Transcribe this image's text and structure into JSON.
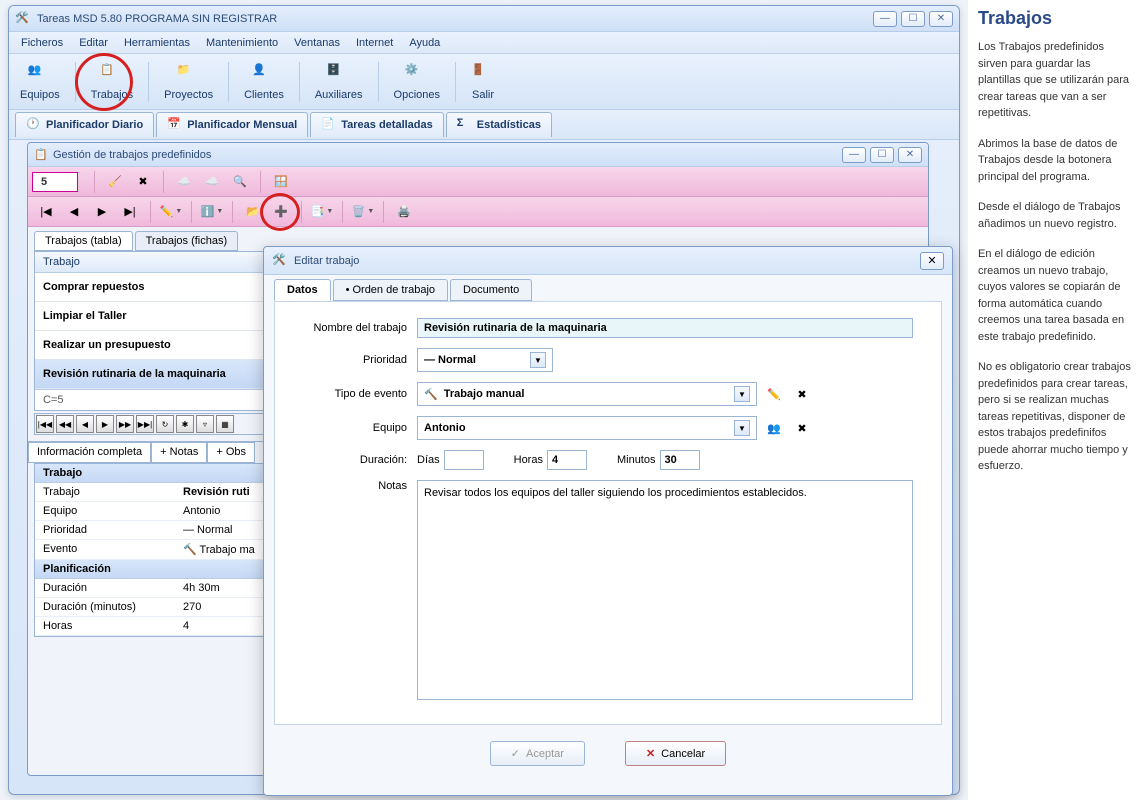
{
  "main_window": {
    "title": "Tareas MSD 5.80 PROGRAMA SIN REGISTRAR"
  },
  "menu": [
    "Ficheros",
    "Editar",
    "Herramientas",
    "Mantenimiento",
    "Ventanas",
    "Internet",
    "Ayuda"
  ],
  "toolbar": [
    {
      "label": "Equipos",
      "icon": "team-icon"
    },
    {
      "label": "Trabajos",
      "icon": "job-icon"
    },
    {
      "label": "Proyectos",
      "icon": "project-icon"
    },
    {
      "label": "Clientes",
      "icon": "client-icon"
    },
    {
      "label": "Auxiliares",
      "icon": "aux-icon"
    },
    {
      "label": "Opciones",
      "icon": "options-icon"
    },
    {
      "label": "Salir",
      "icon": "exit-icon"
    }
  ],
  "tabs": [
    "Planificador Diario",
    "Planificador Mensual",
    "Tareas detalladas",
    "Estadísticas"
  ],
  "child_window": {
    "title": "Gestión de trabajos predefinidos",
    "counter": "5",
    "table_tabs": [
      "Trabajos (tabla)",
      "Trabajos (fichas)"
    ],
    "header": "Trabajo",
    "rows": [
      "Comprar repuestos",
      "Limpiar el Taller",
      "Realizar un presupuesto",
      "Revisión rutinaria de la maquinaria"
    ],
    "footer": "C=5",
    "detail_tabs": [
      "Información completa",
      "+ Notas",
      "+ Obs"
    ],
    "detail": {
      "section1": "Trabajo",
      "trabajo_label": "Trabajo",
      "trabajo_val": "Revisión ruti",
      "equipo_label": "Equipo",
      "equipo_val": "Antonio",
      "prioridad_label": "Prioridad",
      "prioridad_val": "— Normal",
      "evento_label": "Evento",
      "evento_val": "🔨 Trabajo ma",
      "section2": "Planificación",
      "duracion_label": "Duración",
      "duracion_val": "4h 30m",
      "durmin_label": "Duración (minutos)",
      "durmin_val": "270",
      "horas_label": "Horas",
      "horas_val": "4"
    }
  },
  "dialog": {
    "title": "Editar trabajo",
    "tabs": [
      "Datos",
      "• Orden de trabajo",
      "Documento"
    ],
    "fields": {
      "nombre_label": "Nombre del trabajo",
      "nombre_val": "Revisión rutinaria de la maquinaria",
      "prioridad_label": "Prioridad",
      "prioridad_val": "— Normal",
      "tipo_label": "Tipo de evento",
      "tipo_val": "Trabajo manual",
      "equipo_label": "Equipo",
      "equipo_val": "Antonio",
      "duracion_label": "Duración:",
      "dias_label": "Días",
      "dias_val": "",
      "horas_label": "Horas",
      "horas_val": "4",
      "minutos_label": "Minutos",
      "minutos_val": "30",
      "notas_label": "Notas",
      "notas_val": "Revisar todos los equipos del taller siguiendo los procedimientos establecidos."
    },
    "btn_ok": "Aceptar",
    "btn_cancel": "Cancelar"
  },
  "help": {
    "title": "Trabajos",
    "p1": "Los Trabajos predefinidos sirven para guardar las plantillas que se utilizarán para crear tareas que van a ser repetitivas.",
    "p2": "Abrimos la base de datos de Trabajos desde la botonera principal del programa.",
    "p3": "Desde el diálogo de Trabajos añadimos un nuevo registro.",
    "p4": "En el diálogo de edición creamos un nuevo trabajo, cuyos valores se copiarán de forma automática cuando creemos una tarea basada en este trabajo predefinido.",
    "p5": "No es obligatorio crear trabajos predefinidos para crear tareas, pero si se realizan muchas tareas repetitivas, disponer de estos trabajos predefinifos puede ahorrar mucho tiempo y esfuerzo."
  }
}
